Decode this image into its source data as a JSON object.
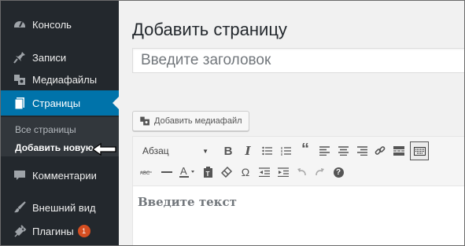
{
  "sidebar": {
    "items": [
      {
        "label": "Консоль",
        "icon": "dashboard-icon"
      },
      {
        "label": "Записи",
        "icon": "pin-icon"
      },
      {
        "label": "Медиафайлы",
        "icon": "media-icon"
      },
      {
        "label": "Страницы",
        "icon": "pages-icon"
      },
      {
        "label": "Комментарии",
        "icon": "comment-icon"
      },
      {
        "label": "Внешний вид",
        "icon": "brush-icon"
      },
      {
        "label": "Плагины",
        "icon": "plugin-icon",
        "badge": "1"
      }
    ],
    "submenu": [
      {
        "label": "Все страницы"
      },
      {
        "label": "Добавить новую"
      }
    ]
  },
  "main": {
    "page_title": "Добавить страницу",
    "title_placeholder": "Введите заголовок",
    "media_button": "Добавить медиафайл",
    "editor": {
      "format_select": "Абзац",
      "bold": "B",
      "italic": "I",
      "quote": "“",
      "omega": "Ω",
      "help": "?",
      "content_placeholder": "Введите текст"
    }
  },
  "colors": {
    "sidebar_bg": "#23282d",
    "active_bg": "#0073aa",
    "submenu_bg": "#32373c",
    "badge": "#d54e21",
    "content_bg": "#f1f1f1"
  }
}
